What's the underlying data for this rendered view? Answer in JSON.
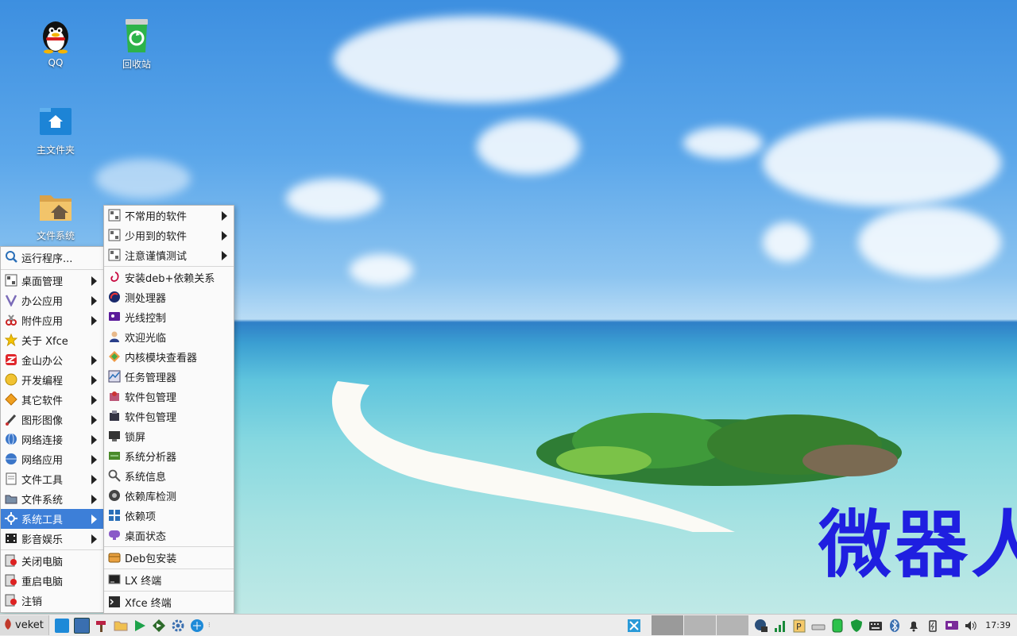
{
  "desktop": {
    "icons": [
      {
        "label": "QQ"
      },
      {
        "label": "回收站"
      },
      {
        "label": "主文件夹"
      },
      {
        "label": "文件系统"
      }
    ],
    "watermark": "微器人"
  },
  "main_menu": {
    "items": [
      {
        "label": "运行程序...",
        "icon": "run-icon"
      },
      {
        "label": "桌面管理",
        "icon": "desktop-manage-icon",
        "submenu": true
      },
      {
        "label": "办公应用",
        "icon": "office-icon",
        "submenu": true
      },
      {
        "label": "附件应用",
        "icon": "accessories-icon",
        "submenu": true
      },
      {
        "label": "关于 Xfce",
        "icon": "star-icon"
      },
      {
        "label": "金山办公",
        "icon": "wps-icon",
        "submenu": true
      },
      {
        "label": "开发编程",
        "icon": "dev-icon",
        "submenu": true
      },
      {
        "label": "其它软件",
        "icon": "other-icon",
        "submenu": true
      },
      {
        "label": "图形图像",
        "icon": "graphics-icon",
        "submenu": true
      },
      {
        "label": "网络连接",
        "icon": "network-connect-icon",
        "submenu": true
      },
      {
        "label": "网络应用",
        "icon": "network-app-icon",
        "submenu": true
      },
      {
        "label": "文件工具",
        "icon": "file-tools-icon",
        "submenu": true
      },
      {
        "label": "文件系统",
        "icon": "filesystem-icon",
        "submenu": true
      },
      {
        "label": "系统工具",
        "icon": "system-tools-icon",
        "submenu": true,
        "selected": true
      },
      {
        "label": "影音娱乐",
        "icon": "multimedia-icon",
        "submenu": true
      },
      {
        "label": "关闭电脑",
        "icon": "shutdown-icon"
      },
      {
        "label": "重启电脑",
        "icon": "reboot-icon"
      },
      {
        "label": "注销",
        "icon": "logout-icon"
      }
    ]
  },
  "sub_menu": {
    "items": [
      {
        "label": "不常用的软件",
        "icon": "app-grid-icon",
        "submenu": true
      },
      {
        "label": "少用到的软件",
        "icon": "app-grid-icon",
        "submenu": true
      },
      {
        "label": "注意谨慎测试",
        "icon": "app-grid-icon",
        "submenu": true
      },
      {
        "label": "安装deb+依赖关系",
        "icon": "debian-icon"
      },
      {
        "label": "测处理器",
        "icon": "cpu-test-icon"
      },
      {
        "label": "光线控制",
        "icon": "brightness-icon"
      },
      {
        "label": "欢迎光临",
        "icon": "welcome-icon"
      },
      {
        "label": "内核模块查看器",
        "icon": "kernel-module-icon"
      },
      {
        "label": "任务管理器",
        "icon": "task-manager-icon"
      },
      {
        "label": "软件包管理",
        "icon": "package-manager-icon"
      },
      {
        "label": "软件包管理",
        "icon": "package-manager-2-icon"
      },
      {
        "label": "锁屏",
        "icon": "lock-screen-icon"
      },
      {
        "label": "系统分析器",
        "icon": "system-analyzer-icon"
      },
      {
        "label": "系统信息",
        "icon": "magnifier-icon"
      },
      {
        "label": "依赖库检测",
        "icon": "library-check-icon"
      },
      {
        "label": "依赖项",
        "icon": "dependencies-icon"
      },
      {
        "label": "桌面状态",
        "icon": "desktop-status-icon"
      },
      {
        "label": "Deb包安装",
        "icon": "deb-install-icon"
      },
      {
        "label": "LX 终端",
        "icon": "lx-terminal-icon"
      },
      {
        "label": "Xfce 终端",
        "icon": "xfce-terminal-icon"
      }
    ]
  },
  "taskbar": {
    "start_label": "veket",
    "launchers": [
      "show-desktop-icon",
      "screenshot-icon",
      "hammer-icon",
      "folder-icon",
      "play-icon",
      "update-icon",
      "settings-icon",
      "browser-icon"
    ],
    "tray": [
      "network-icon",
      "signal-icon",
      "clipboard-icon",
      "disk-icon",
      "battery-green-icon",
      "shield-icon",
      "keyboard-icon",
      "bluetooth-icon",
      "bell-icon",
      "power-icon",
      "display-icon",
      "volume-icon"
    ],
    "clock": "17:39"
  },
  "colors": {
    "menu_selected": "#3d7fd8",
    "watermark": "#1f1fe0"
  }
}
